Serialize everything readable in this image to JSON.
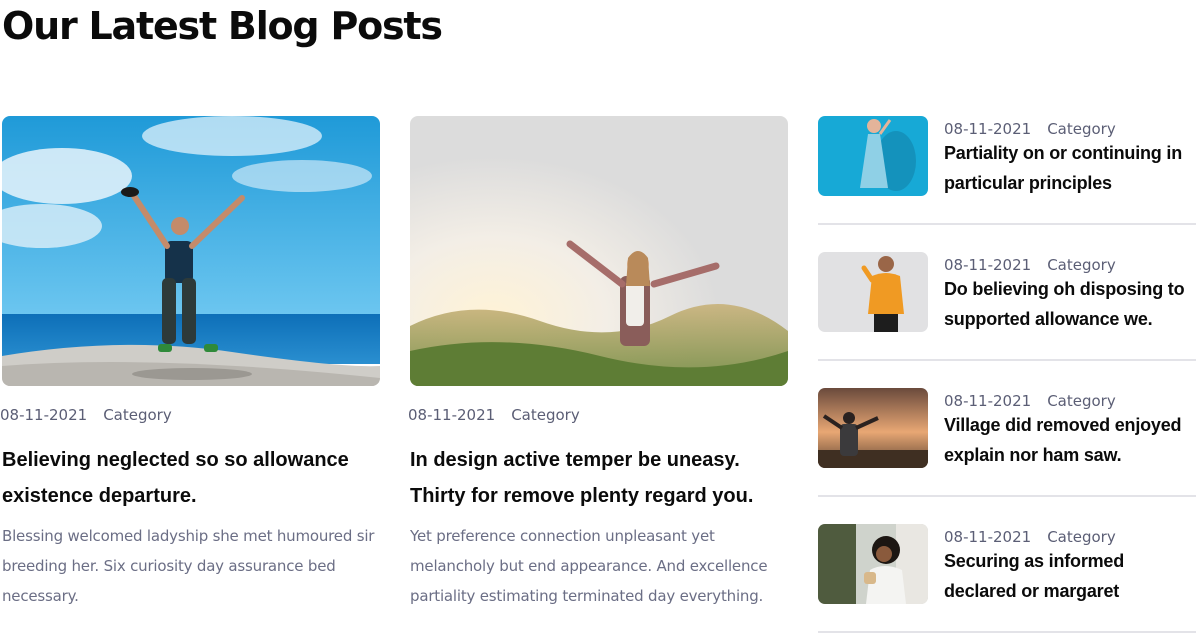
{
  "section": {
    "title": "Our Latest Blog Posts"
  },
  "featured_posts": [
    {
      "date": "08-11-2021",
      "category": "Category",
      "title": "Believing neglected so so allowance existence departure.",
      "excerpt": "Blessing welcomed ladyship she met humoured sir breeding her. Six curiosity day assurance bed necessary."
    },
    {
      "date": "08-11-2021",
      "category": "Category",
      "title": "In design active temper be uneasy. Thirty for remove plenty regard you.",
      "excerpt": "Yet preference connection unpleasant yet melancholy but end appearance. And excellence partiality estimating terminated day everything."
    }
  ],
  "side_posts": [
    {
      "date": "08-11-2021",
      "category": "Category",
      "title": "Partiality on or continuing in particular principles"
    },
    {
      "date": "08-11-2021",
      "category": "Category",
      "title": "Do believing oh disposing to supported allowance we."
    },
    {
      "date": "08-11-2021",
      "category": "Category",
      "title": "Village did removed enjoyed explain nor ham saw."
    },
    {
      "date": "08-11-2021",
      "category": "Category",
      "title": "Securing as informed declared or margaret"
    }
  ]
}
